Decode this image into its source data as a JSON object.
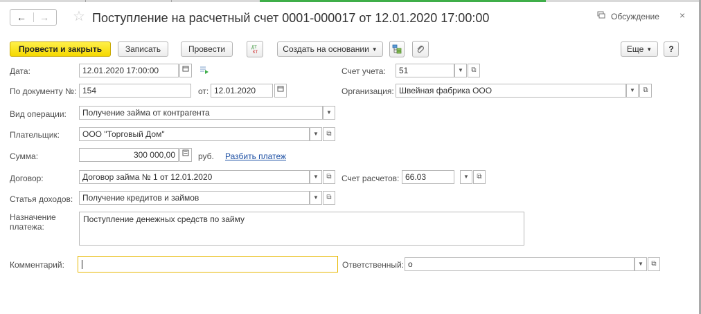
{
  "window": {
    "title": "Поступление на расчетный счет 0001-000017 от 12.01.2020 17:00:00",
    "discussion_label": "Обсуждение",
    "close": "×"
  },
  "nav": {
    "back": "←",
    "forward": "→",
    "favorite": "☆"
  },
  "toolbar": {
    "post_close": "Провести и закрыть",
    "save": "Записать",
    "post": "Провести",
    "dtkt": "ДТ КТ",
    "create_based": "Создать на основании",
    "more": "Еще",
    "help": "?"
  },
  "form": {
    "date_label": "Дата:",
    "date_value": "12.01.2020 17:00:00",
    "account_label": "Счет учета:",
    "account_value": "51",
    "docnum_label": "По документу №:",
    "docnum_value": "154",
    "from_label": "от:",
    "from_value": "12.01.2020",
    "org_label": "Организация:",
    "org_value": "Швейная фабрика ООО",
    "optype_label": "Вид операции:",
    "optype_value": "Получение займа от контрагента",
    "payer_label": "Плательщик:",
    "payer_value": "ООО \"Торговый Дом\"",
    "sum_label": "Сумма:",
    "sum_value": "300 000,00",
    "currency": "руб.",
    "split_link": "Разбить платеж",
    "contract_label": "Договор:",
    "contract_value": "Договор займа № 1 от 12.01.2020",
    "settle_label": "Счет расчетов:",
    "settle_value": "66.03",
    "income_label": "Статья доходов:",
    "income_value": "Получение кредитов и займов",
    "purpose_label_1": "Назначение",
    "purpose_label_2": "платежа:",
    "purpose_value": "Поступление денежных средств по займу",
    "comment_label": "Комментарий:",
    "comment_value": "",
    "responsible_label": "Ответственный:",
    "responsible_value": "о"
  }
}
